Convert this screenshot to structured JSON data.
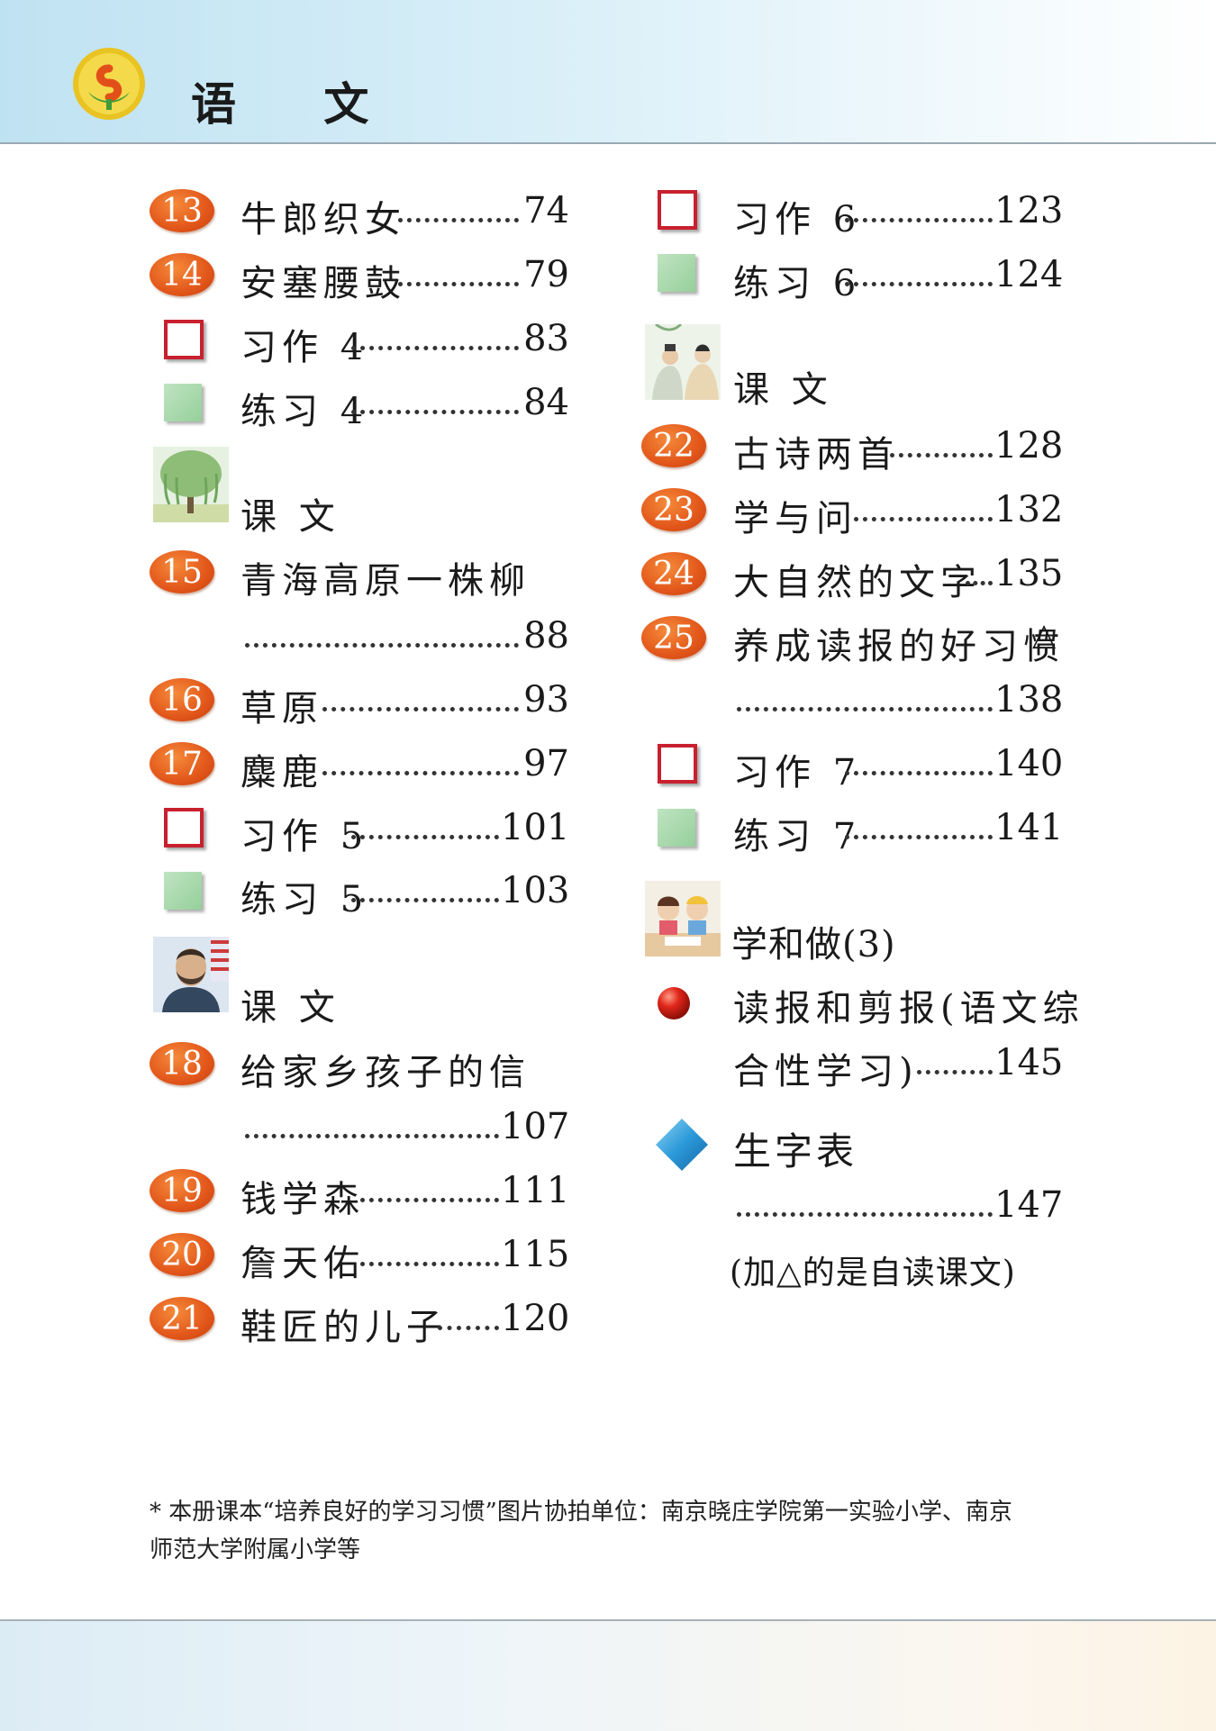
{
  "header": {
    "subject": "语 文"
  },
  "left": {
    "e13": {
      "num": "13",
      "title": "牛郎织女",
      "page": "74"
    },
    "e14": {
      "num": "14",
      "title": "安塞腰鼓",
      "page": "79"
    },
    "x4": {
      "title": "习作 4",
      "page": "83"
    },
    "p4": {
      "title": "练习 4",
      "page": "84"
    },
    "s1": {
      "title": "课 文"
    },
    "e15": {
      "num": "15",
      "title": "青海高原一株柳",
      "page": "88"
    },
    "e16": {
      "num": "16",
      "title": "草原",
      "page": "93"
    },
    "e17": {
      "num": "17",
      "title": "麋鹿",
      "page": "97"
    },
    "x5": {
      "title": "习作 5",
      "page": "101"
    },
    "p5": {
      "title": "练习 5",
      "page": "103"
    },
    "s2": {
      "title": "课 文"
    },
    "e18": {
      "num": "18",
      "title": "给家乡孩子的信",
      "page": "107"
    },
    "e19": {
      "num": "19",
      "title": "钱学森",
      "page": "111"
    },
    "e20": {
      "num": "20",
      "title": "詹天佑",
      "page": "115"
    },
    "e21": {
      "num": "21",
      "title": "鞋匠的儿子",
      "page": "120"
    }
  },
  "right": {
    "x6": {
      "title": "习作 6",
      "page": "123"
    },
    "p6": {
      "title": "练习 6",
      "page": "124"
    },
    "s3": {
      "title": "课 文"
    },
    "e22": {
      "num": "22",
      "title": "古诗两首",
      "page": "128"
    },
    "e23": {
      "num": "23",
      "title": "学与问",
      "page": "132"
    },
    "e24": {
      "num": "24",
      "title": "大自然的文字",
      "page": "135"
    },
    "e25": {
      "num": "25",
      "title": "养成读报的好习惯",
      "mark": "△",
      "page": "138"
    },
    "x7": {
      "title": "习作 7",
      "page": "140"
    },
    "p7": {
      "title": "练习 7",
      "page": "141"
    },
    "s4": {
      "title": "学和做(3)"
    },
    "act": {
      "line1": "读报和剪报(语文综",
      "line2": "合性学习)",
      "page": "145"
    },
    "glossary": {
      "title": "生字表",
      "page": "147"
    },
    "legend": "(加△的是自读课文)"
  },
  "footnote": {
    "line1": "* 本册课本“培养良好的学习习惯”图片协拍单位：南京晓庄学院第一实验小学、南京",
    "line2": "师范大学附属小学等"
  }
}
